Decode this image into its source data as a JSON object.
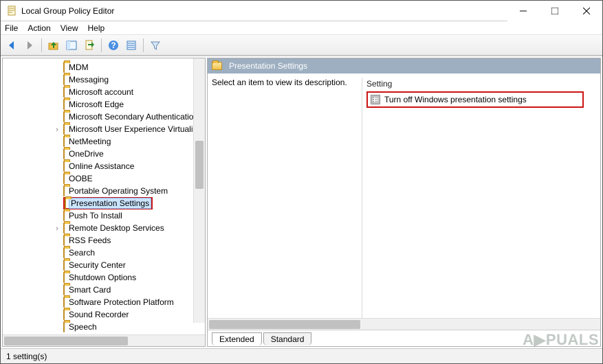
{
  "window": {
    "title": "Local Group Policy Editor",
    "controls": {
      "min": "–",
      "max": "▢",
      "close": "✕"
    }
  },
  "menubar": {
    "items": [
      "File",
      "Action",
      "View",
      "Help"
    ]
  },
  "tree": {
    "highlight_index": 11,
    "items": [
      {
        "label": "MDM",
        "expandable": false
      },
      {
        "label": "Messaging",
        "expandable": false
      },
      {
        "label": "Microsoft account",
        "expandable": false
      },
      {
        "label": "Microsoft Edge",
        "expandable": false
      },
      {
        "label": "Microsoft Secondary Authentication",
        "expandable": false,
        "truncated": true
      },
      {
        "label": "Microsoft User Experience Virtualiz",
        "expandable": true,
        "truncated": true
      },
      {
        "label": "NetMeeting",
        "expandable": false
      },
      {
        "label": "OneDrive",
        "expandable": false
      },
      {
        "label": "Online Assistance",
        "expandable": false
      },
      {
        "label": "OOBE",
        "expandable": false
      },
      {
        "label": "Portable Operating System",
        "expandable": false
      },
      {
        "label": "Presentation Settings",
        "expandable": false,
        "selected": true
      },
      {
        "label": "Push To Install",
        "expandable": false
      },
      {
        "label": "Remote Desktop Services",
        "expandable": true
      },
      {
        "label": "RSS Feeds",
        "expandable": false
      },
      {
        "label": "Search",
        "expandable": false
      },
      {
        "label": "Security Center",
        "expandable": false
      },
      {
        "label": "Shutdown Options",
        "expandable": false
      },
      {
        "label": "Smart Card",
        "expandable": false
      },
      {
        "label": "Software Protection Platform",
        "expandable": false
      },
      {
        "label": "Sound Recorder",
        "expandable": false
      },
      {
        "label": "Speech",
        "expandable": false
      }
    ]
  },
  "details": {
    "header": "Presentation Settings",
    "description_prompt": "Select an item to view its description.",
    "column_header": "Setting",
    "settings": [
      {
        "label": "Turn off Windows presentation settings"
      }
    ],
    "tabs": {
      "active": "Extended",
      "inactive": "Standard"
    }
  },
  "statusbar": {
    "text": "1 setting(s)"
  },
  "watermark": "A▶PUALS"
}
